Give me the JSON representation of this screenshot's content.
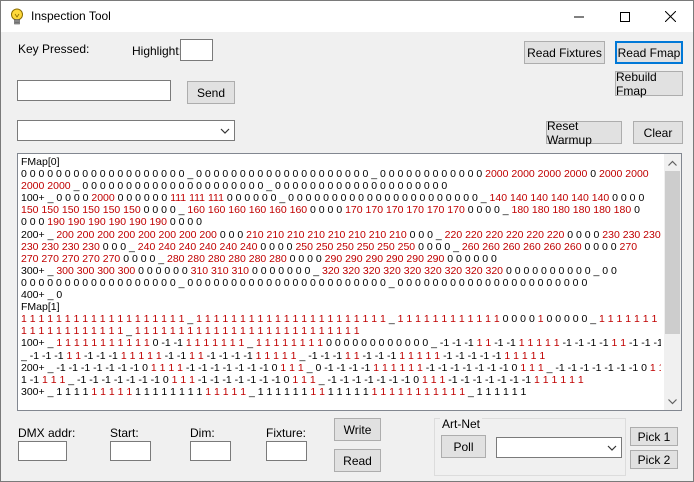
{
  "window": {
    "title": "Inspection Tool"
  },
  "labels": {
    "key_pressed": "Key Pressed:",
    "highlight": "Highlight:",
    "dmx_addr": "DMX addr:",
    "start": "Start:",
    "dim": "Dim:",
    "fixture": "Fixture:",
    "artnet": "Art-Net"
  },
  "buttons": {
    "read_fixtures": "Read Fixtures",
    "read_fmap": "Read Fmap",
    "rebuild_fmap": "Rebuild Fmap",
    "send": "Send",
    "reset_warmup": "Reset Warmup",
    "clear": "Clear",
    "write": "Write",
    "read": "Read",
    "poll": "Poll",
    "pick1": "Pick 1",
    "pick2": "Pick 2"
  },
  "inputs": {
    "highlight": "",
    "send": "",
    "dmx_addr": "",
    "start": "",
    "dim": "",
    "fixture": ""
  },
  "combos": {
    "main": "",
    "artnet": ""
  },
  "colors": {
    "black": "#000000",
    "red": "#c00000",
    "accent": "#0078d7"
  },
  "log_lines": [
    [
      [
        "b",
        "FMap[0]"
      ]
    ],
    [
      [
        "b",
        "0 0 0 0 0 0 0 0 0 0 0 0 0 0 0 0 0 0 0 _ 0 0 0 0 0 0 0 0 0 0 0 0 0 0 0 0 0 0 0 0 _ 0 0 0 0 0 0 0 0 0 0 0 0 "
      ],
      [
        "r",
        "2000 2000 2000 2000 "
      ],
      [
        "b",
        "0 "
      ],
      [
        "r",
        "2000 2000"
      ]
    ],
    [
      [
        "r",
        "2000 2000 "
      ],
      [
        "b",
        "_ 0 0 0 0 0 0 0 0 0 0 0 0 0 0 0 0 0 0 0 0 0 _ 0 0 0 0 0 0 0 0 0 0 0 0 0 0 0 0 0 0 0 0"
      ]
    ],
    [
      [
        "b",
        "100+ _ 0 0 0 0 "
      ],
      [
        "r",
        "2000 "
      ],
      [
        "b",
        "0 0 0 0 0 0 "
      ],
      [
        "r",
        "111 111 111 "
      ],
      [
        "b",
        "0 0 0 0 0 0 _ 0 0 0 0 0 0 0 0 0 0 0 0 0 0 0 0 0 0 0 0 0 0 _ "
      ],
      [
        "r",
        "140 140 140 140 140 140 "
      ],
      [
        "b",
        "0 0 0 0"
      ]
    ],
    [
      [
        "r",
        "150 150 150 150 150 150 "
      ],
      [
        "b",
        "0 0 0 0 _ "
      ],
      [
        "r",
        "160 160 160 160 160 160 "
      ],
      [
        "b",
        "0 0 0 0 "
      ],
      [
        "r",
        "170 170 170 170 170 170 "
      ],
      [
        "b",
        "0 0 0 0 _ "
      ],
      [
        "r",
        "180 180 180 180 180 180 "
      ],
      [
        "b",
        "0"
      ]
    ],
    [
      [
        "b",
        "0 0 0 "
      ],
      [
        "r",
        "190 190 190 190 190 190 "
      ],
      [
        "b",
        "0 0 0 0"
      ]
    ],
    [
      [
        "b",
        "200+ _ "
      ],
      [
        "r",
        "200 200 200 200 200 200 200 200 "
      ],
      [
        "b",
        "0 0 0 "
      ],
      [
        "r",
        "210 210 210 210 210 210 210 210 "
      ],
      [
        "b",
        "0 0 0 _ "
      ],
      [
        "r",
        "220 220 220 220 220 220 "
      ],
      [
        "b",
        "0 0 0 0 "
      ],
      [
        "r",
        "230 230 230 230"
      ]
    ],
    [
      [
        "r",
        "230 230 230 230 "
      ],
      [
        "b",
        "0 0 0 _ "
      ],
      [
        "r",
        "240 240 240 240 240 240 "
      ],
      [
        "b",
        "0 0 0 0 "
      ],
      [
        "r",
        "250 250 250 250 250 250 "
      ],
      [
        "b",
        "0 0 0 0 _ "
      ],
      [
        "r",
        "260 260 260 260 260 260 "
      ],
      [
        "b",
        "0 0 0 0 "
      ],
      [
        "r",
        "270"
      ]
    ],
    [
      [
        "r",
        "270 270 270 270 270 "
      ],
      [
        "b",
        "0 0 0 0 _ "
      ],
      [
        "r",
        "280 280 280 280 280 280 "
      ],
      [
        "b",
        "0 0 0 0 "
      ],
      [
        "r",
        "290 290 290 290 290 290 "
      ],
      [
        "b",
        "0 0 0 0 0 0"
      ]
    ],
    [
      [
        "b",
        "300+ _ "
      ],
      [
        "r",
        "300 300 300 300 "
      ],
      [
        "b",
        "0 0 0 0 0 0 "
      ],
      [
        "r",
        "310 310 310 "
      ],
      [
        "b",
        "0 0 0 0 0 0 0 _ "
      ],
      [
        "r",
        "320 320 320 320 320 320 320 320 320 "
      ],
      [
        "b",
        "0 0 0 0 0 0 0 0 0 0 _ 0 0"
      ]
    ],
    [
      [
        "b",
        "0 0 0 0 0 0 0 0 0 0 0 0 0 0 0 0 0 0 _ 0 0 0 0 0 0 0 0 0 0 0 0 0 0 0 0 0 0 0 0 0 0 0 _ 0 0 0 0 0 0 0 0 0 0 0 0 0 0 0 0 0 0 0 0 0 0"
      ]
    ],
    [
      [
        "b",
        "400+ _ 0"
      ]
    ],
    [
      [
        "b",
        "FMap[1]"
      ]
    ],
    [
      [
        "r",
        "1 1 1 1 1 1 1 1 1 1 1 1 1 1 1 1 1 1 1 "
      ],
      [
        "b",
        "_ "
      ],
      [
        "r",
        "1 1 1 1 1 1 1 1 1 1 1 1 1 1 1 1 1 1 1 1 1 1 "
      ],
      [
        "b",
        "_ "
      ],
      [
        "r",
        "1 1 1 1 1 1 1 1 1 1 1 1 "
      ],
      [
        "b",
        "0 0 0 0 "
      ],
      [
        "r",
        "1 "
      ],
      [
        "b",
        "0 0 0 0 0 _ "
      ],
      [
        "r",
        "1 1 1 1 1 1 1 1 1 1 1"
      ]
    ],
    [
      [
        "r",
        "1 1 1 1 1 1 1 1 1 1 1 1 "
      ],
      [
        "b",
        "_ "
      ],
      [
        "r",
        "1 1 1 1 1 1 1 1 1 1 1 1 1 1 1 1 1 1 1 1 1 1 1 1 1 1"
      ]
    ],
    [
      [
        "b",
        "100+ _ "
      ],
      [
        "r",
        "1 1 1 1 1 1 1 1 1 1 1 "
      ],
      [
        "b",
        "0 -1 -1 "
      ],
      [
        "r",
        "1 1 1 1 1 1 1 "
      ],
      [
        "b",
        "_ "
      ],
      [
        "r",
        "1 1 1 1 1 1 1 1 "
      ],
      [
        "b",
        "0 0 0 0 0 0 0 0 0 0 0 0 _ -1 -1 -1 "
      ],
      [
        "r",
        "1 1 "
      ],
      [
        "b",
        "-1 -1 "
      ],
      [
        "r",
        "1 1 1 1 1 "
      ],
      [
        "b",
        "-1 -1 -1 -1 "
      ],
      [
        "r",
        "1 1 "
      ],
      [
        "b",
        "-1 -1 -1 "
      ],
      [
        "r",
        "1 1 1 1"
      ]
    ],
    [
      [
        "b",
        "_ -1 -1 -1 "
      ],
      [
        "r",
        "1 1 "
      ],
      [
        "b",
        "-1 -1 -1 "
      ],
      [
        "r",
        "1 1 1 1 1 "
      ],
      [
        "b",
        "-1 -1 "
      ],
      [
        "r",
        "1 1 "
      ],
      [
        "b",
        "-1 -1 -1 -1 "
      ],
      [
        "r",
        "1 1 1 1 1 "
      ],
      [
        "b",
        "_ -1 -1 -1 "
      ],
      [
        "r",
        "1 1 "
      ],
      [
        "b",
        "-1 -1 -1 "
      ],
      [
        "r",
        "1 1 1 1 1 "
      ],
      [
        "b",
        "-1 -1 -1 -1 -1 "
      ],
      [
        "r",
        "1 1 1 1 1"
      ]
    ],
    [
      [
        "b",
        "200+ _ -1 -1 -1 -1 -1 -1 -1 0 "
      ],
      [
        "r",
        "1 1 1 1 "
      ],
      [
        "b",
        "-1 -1 -1 -1 -1 -1 -1 0 "
      ],
      [
        "r",
        "1 1 1 "
      ],
      [
        "b",
        "_ 0 -1 -1 -1 -1 "
      ],
      [
        "r",
        "1 1 1 1 1 1 "
      ],
      [
        "b",
        "-1 -1 -1 -1 -1 -1 -1 0 "
      ],
      [
        "r",
        "1 1 1 "
      ],
      [
        "b",
        "_ -1 -1 -1 -1 -1 -1 -1 0 "
      ],
      [
        "r",
        "1 1 1 "
      ],
      [
        "b",
        "0 -1 -1 -1 -"
      ]
    ],
    [
      [
        "b",
        "1 -1 "
      ],
      [
        "r",
        "1 1 1 "
      ],
      [
        "b",
        "_ -1 -1 -1 -1 -1 -1 -1 0 "
      ],
      [
        "r",
        "1 1 1 "
      ],
      [
        "b",
        "-1 -1 -1 -1 -1 -1 -1 0 "
      ],
      [
        "r",
        "1 1 1 "
      ],
      [
        "b",
        "_ -1 -1 -1 -1 -1 -1 -1 0 "
      ],
      [
        "r",
        "1 1 1 "
      ],
      [
        "b",
        "-1 -1 -1 -1 -1 -1 -1 "
      ],
      [
        "r",
        "1 1 1 1 1 1"
      ]
    ],
    [
      [
        "b",
        "300+ _ 1 1 1 1 "
      ],
      [
        "r",
        "1 1 1 1 1 "
      ],
      [
        "b",
        "1 1 1 1 1 1 1 1 "
      ],
      [
        "r",
        "1 1 1 1 1 "
      ],
      [
        "b",
        "_ 1 1 1 1 1 1 "
      ],
      [
        "r",
        "1 1 "
      ],
      [
        "b",
        "1 1 1 1 1 "
      ],
      [
        "r",
        "1 1 1 1 1 1 1 1 1 1 1 "
      ],
      [
        "b",
        "_ 1 1 1 1 1 1"
      ]
    ]
  ]
}
